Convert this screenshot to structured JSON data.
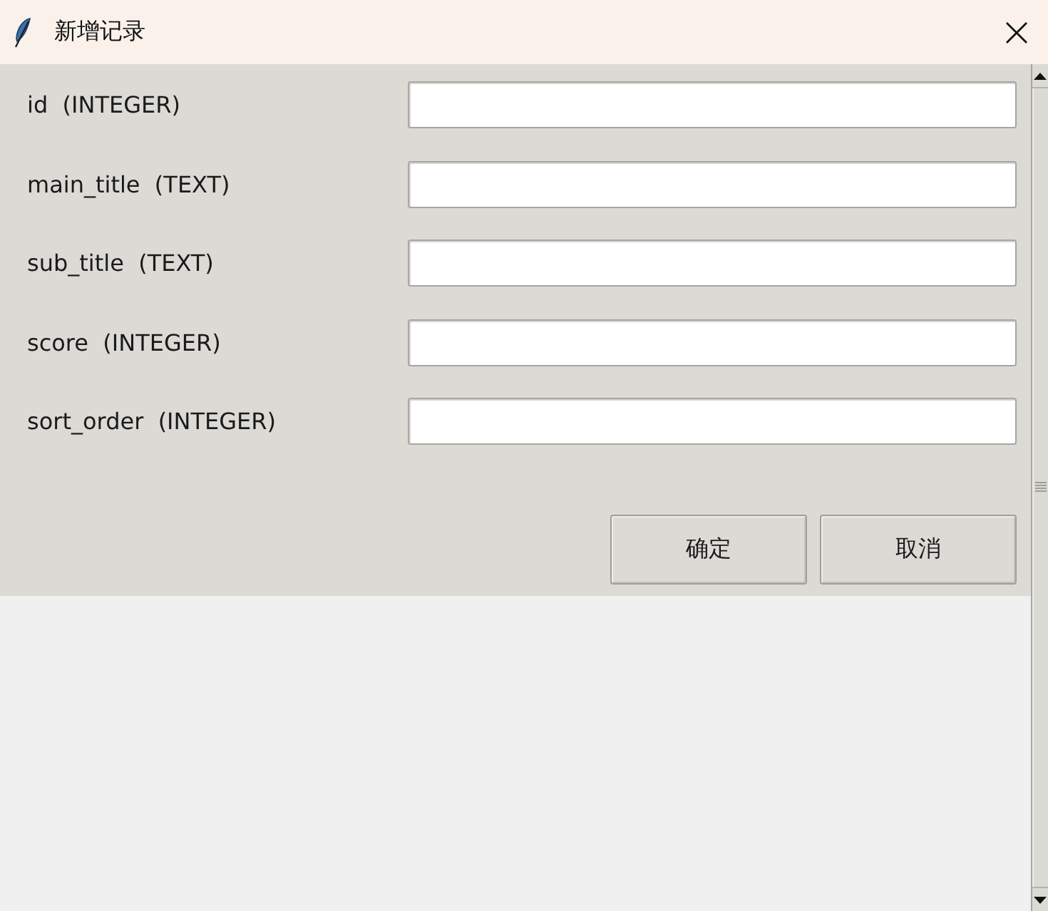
{
  "window": {
    "title": "新增记录"
  },
  "fields": [
    {
      "label": "id  (INTEGER)"
    },
    {
      "label": "main_title  (TEXT)"
    },
    {
      "label": "sub_title  (TEXT)"
    },
    {
      "label": "score  (INTEGER)"
    },
    {
      "label": "sort_order  (INTEGER)"
    }
  ],
  "buttons": [
    "确定",
    "取消"
  ]
}
